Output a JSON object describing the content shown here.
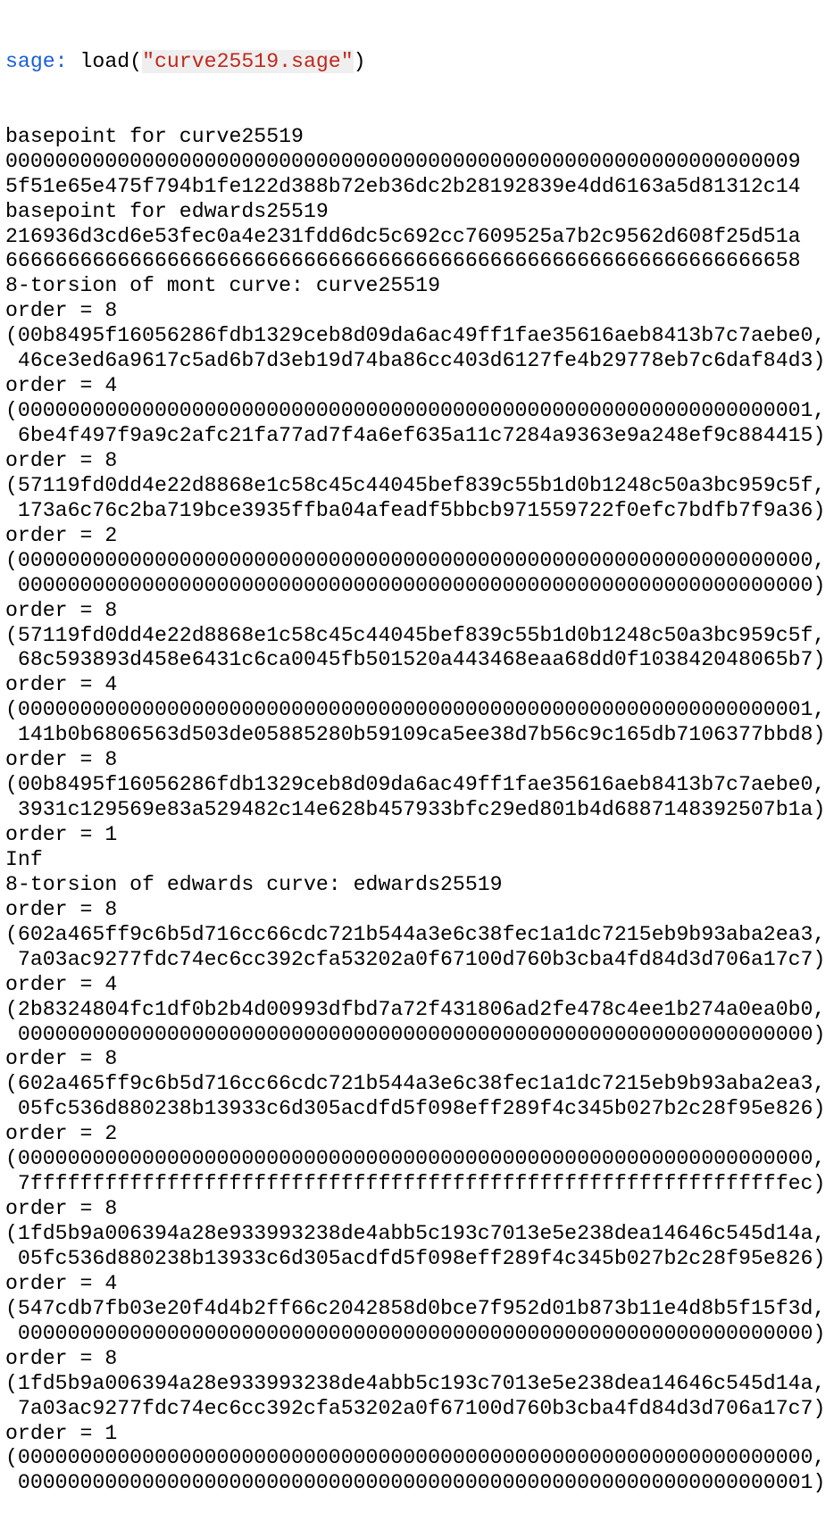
{
  "colors": {
    "prompt": "#1a5fd8",
    "string": "#c0281c",
    "text": "#000000",
    "background": "#ffffff"
  },
  "command": {
    "prompt": "sage: ",
    "func_open": "load(",
    "arg": "\"curve25519.sage\"",
    "func_close": ")"
  },
  "output_lines": [
    "basepoint for curve25519",
    "0000000000000000000000000000000000000000000000000000000000000009",
    "5f51e65e475f794b1fe122d388b72eb36dc2b28192839e4dd6163a5d81312c14",
    "basepoint for edwards25519",
    "216936d3cd6e53fec0a4e231fdd6dc5c692cc7609525a7b2c9562d608f25d51a",
    "6666666666666666666666666666666666666666666666666666666666666658",
    "8-torsion of mont curve: curve25519",
    "order = 8",
    "(00b8495f16056286fdb1329ceb8d09da6ac49ff1fae35616aeb8413b7c7aebe0,",
    " 46ce3ed6a9617c5ad6b7d3eb19d74ba86cc403d6127fe4b29778eb7c6daf84d3)",
    "order = 4",
    "(0000000000000000000000000000000000000000000000000000000000000001,",
    " 6be4f497f9a9c2afc21fa77ad7f4a6ef635a11c7284a9363e9a248ef9c884415)",
    "order = 8",
    "(57119fd0dd4e22d8868e1c58c45c44045bef839c55b1d0b1248c50a3bc959c5f,",
    " 173a6c76c2ba719bce3935ffba04afeadf5bbcb971559722f0efc7bdfb7f9a36)",
    "order = 2",
    "(0000000000000000000000000000000000000000000000000000000000000000,",
    " 0000000000000000000000000000000000000000000000000000000000000000)",
    "order = 8",
    "(57119fd0dd4e22d8868e1c58c45c44045bef839c55b1d0b1248c50a3bc959c5f,",
    " 68c593893d458e6431c6ca0045fb501520a443468eaa68dd0f103842048065b7)",
    "order = 4",
    "(0000000000000000000000000000000000000000000000000000000000000001,",
    " 141b0b6806563d503de05885280b59109ca5ee38d7b56c9c165db7106377bbd8)",
    "order = 8",
    "(00b8495f16056286fdb1329ceb8d09da6ac49ff1fae35616aeb8413b7c7aebe0,",
    " 3931c129569e83a529482c14e628b457933bfc29ed801b4d6887148392507b1a)",
    "order = 1",
    "Inf",
    "8-torsion of edwards curve: edwards25519",
    "order = 8",
    "(602a465ff9c6b5d716cc66cdc721b544a3e6c38fec1a1dc7215eb9b93aba2ea3,",
    " 7a03ac9277fdc74ec6cc392cfa53202a0f67100d760b3cba4fd84d3d706a17c7)",
    "order = 4",
    "(2b8324804fc1df0b2b4d00993dfbd7a72f431806ad2fe478c4ee1b274a0ea0b0,",
    " 0000000000000000000000000000000000000000000000000000000000000000)",
    "order = 8",
    "(602a465ff9c6b5d716cc66cdc721b544a3e6c38fec1a1dc7215eb9b93aba2ea3,",
    " 05fc536d880238b13933c6d305acdfd5f098eff289f4c345b027b2c28f95e826)",
    "order = 2",
    "(0000000000000000000000000000000000000000000000000000000000000000,",
    " 7fffffffffffffffffffffffffffffffffffffffffffffffffffffffffffffec)",
    "order = 8",
    "(1fd5b9a006394a28e933993238de4abb5c193c7013e5e238dea14646c545d14a,",
    " 05fc536d880238b13933c6d305acdfd5f098eff289f4c345b027b2c28f95e826)",
    "order = 4",
    "(547cdb7fb03e20f4d4b2ff66c2042858d0bce7f952d01b873b11e4d8b5f15f3d,",
    " 0000000000000000000000000000000000000000000000000000000000000000)",
    "order = 8",
    "(1fd5b9a006394a28e933993238de4abb5c193c7013e5e238dea14646c545d14a,",
    " 7a03ac9277fdc74ec6cc392cfa53202a0f67100d760b3cba4fd84d3d706a17c7)",
    "order = 1",
    "(0000000000000000000000000000000000000000000000000000000000000000,",
    " 0000000000000000000000000000000000000000000000000000000000000001)"
  ]
}
